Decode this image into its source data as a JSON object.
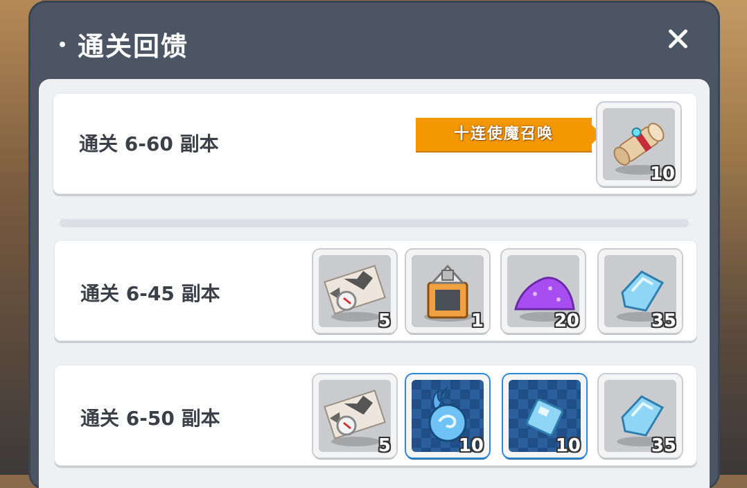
{
  "title": "通关回馈",
  "scroll_tag": "十连使魔召唤",
  "rows": [
    {
      "label": "通关 6-60 副本",
      "items": [
        {
          "icon": "summon-scroll-icon",
          "count": "10"
        }
      ]
    },
    {
      "label": "通关 6-45 副本",
      "items": [
        {
          "icon": "treasure-map-icon",
          "count": "5"
        },
        {
          "icon": "rune-chest-icon",
          "count": "1"
        },
        {
          "icon": "purple-dust-icon",
          "count": "20"
        },
        {
          "icon": "blue-crystal-icon",
          "count": "35"
        }
      ]
    },
    {
      "label": "通关 6-50 副本",
      "items": [
        {
          "icon": "treasure-map-icon",
          "count": "5"
        },
        {
          "icon": "blue-flame-orb-icon",
          "count": "10"
        },
        {
          "icon": "blue-cube-icon",
          "count": "10"
        },
        {
          "icon": "blue-crystal-icon",
          "count": "35"
        }
      ]
    }
  ],
  "colors": {
    "panel": "#4c5564",
    "accent": "#f39800",
    "rare_frame": "#2c87d8"
  }
}
